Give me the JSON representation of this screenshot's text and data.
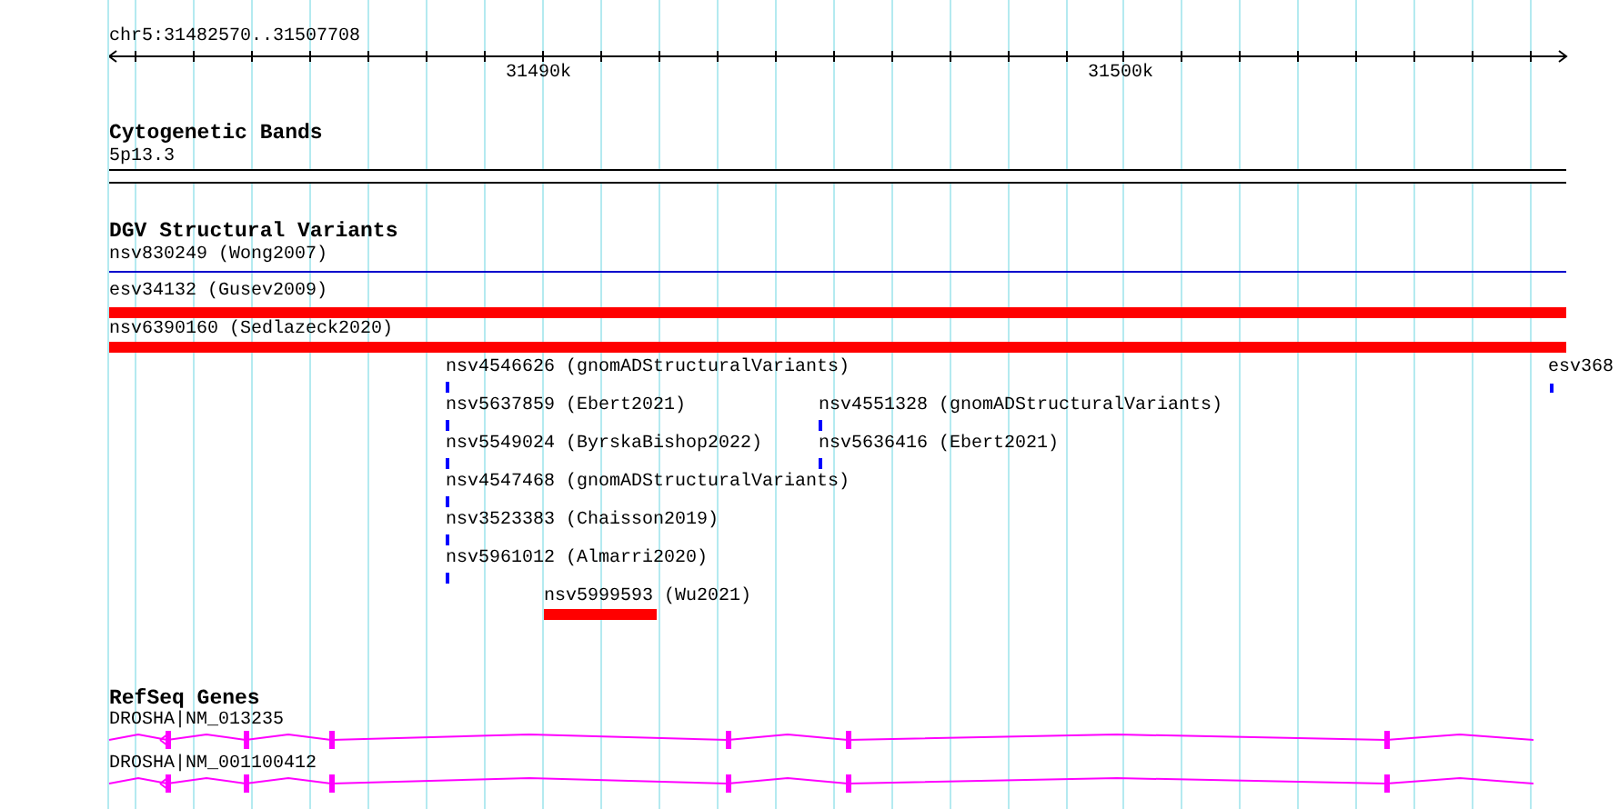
{
  "ruler": {
    "location": "chr5:31482570..31507708",
    "ticks": [
      "31490k",
      "31500k"
    ]
  },
  "tracks": [
    {
      "kind": "bands",
      "title": "Cytogenetic Bands",
      "features": [
        {
          "label": "5p13.3"
        }
      ]
    },
    {
      "kind": "variants",
      "title": "DGV Structural Variants",
      "features": [
        {
          "label": "nsv830249 (Wong2007)",
          "color": "#0000cc"
        },
        {
          "label": "esv34132 (Gusev2009)",
          "color": "#ff0000"
        },
        {
          "label": "nsv6390160 (Sedlazeck2020)",
          "color": "#ff0000"
        },
        {
          "label": "nsv4546626 (gnomADStructuralVariants)",
          "color": "#0000ff"
        },
        {
          "label": "esv368",
          "color": "#0000ff"
        },
        {
          "label": "nsv5637859 (Ebert2021)",
          "color": "#0000ff"
        },
        {
          "label": "nsv4551328 (gnomADStructuralVariants)",
          "color": "#0000ff"
        },
        {
          "label": "nsv5549024 (ByrskaBishop2022)",
          "color": "#0000ff"
        },
        {
          "label": "nsv5636416 (Ebert2021)",
          "color": "#0000ff"
        },
        {
          "label": "nsv4547468 (gnomADStructuralVariants)",
          "color": "#0000ff"
        },
        {
          "label": "nsv3523383 (Chaisson2019)",
          "color": "#0000ff"
        },
        {
          "label": "nsv5961012 (Almarri2020)",
          "color": "#0000ff"
        },
        {
          "label": "nsv5999593 (Wu2021)",
          "color": "#ff0000"
        }
      ]
    },
    {
      "kind": "genes",
      "title": "RefSeq Genes",
      "features": [
        {
          "label": "DROSHA|NM_013235"
        },
        {
          "label": "DROSHA|NM_001100412"
        }
      ]
    }
  ]
}
